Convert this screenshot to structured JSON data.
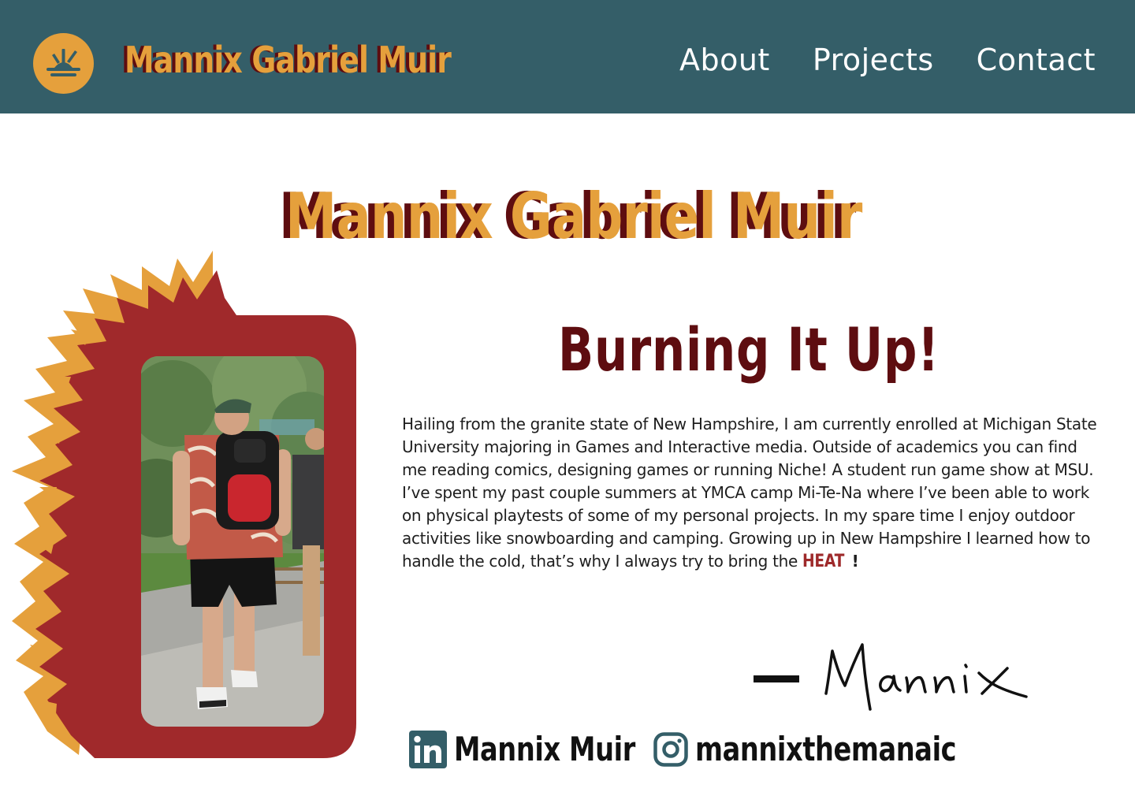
{
  "header": {
    "name": "Mannix Gabriel Muir",
    "logo_icon": "sunrise-burst-icon",
    "nav": [
      {
        "label": "About"
      },
      {
        "label": "Projects"
      },
      {
        "label": "Contact"
      }
    ]
  },
  "hero": {
    "name": "Mannix Gabriel Muir"
  },
  "about": {
    "title": "Burning It Up!",
    "bio": "Hailing from the granite state of New Hampshire, I am currently enrolled at Michigan State University majoring in Games and Interactive media. Outside of academics you can find me reading comics, designing games or running Niche! A student run game show at MSU. I’ve spent my past couple summers at YMCA camp Mi-Te-Na where I’ve been able to work on physical playtests of some of my personal projects. In my spare time I enjoy outdoor activities like snowboarding and camping. Growing up in New Hampshire I learned how to handle the cold, that’s why I always try to bring the ",
    "bio_emphasis": "HEAT",
    "bio_end": "!",
    "signature": "Mannix"
  },
  "social": {
    "linkedin": {
      "icon": "linkedin-icon",
      "label": "Mannix Muir"
    },
    "instagram": {
      "icon": "instagram-icon",
      "label": "mannixthemanaic"
    }
  },
  "colors": {
    "header_bg": "#345e68",
    "accent_gold": "#e5a03c",
    "maroon": "#5e0d10",
    "flame_red": "#a0292b",
    "text": "#1e1e1e"
  }
}
